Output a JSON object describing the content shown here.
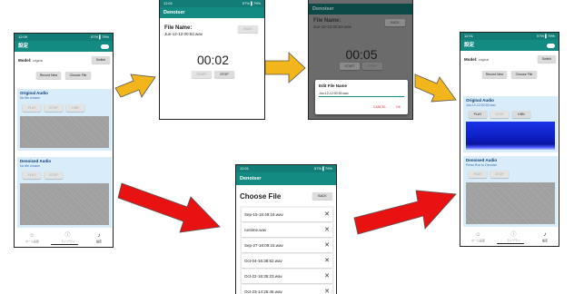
{
  "phone1": {
    "status_time": "12:09",
    "status_right": "57% ▌79%",
    "app_title": "設定",
    "model_label": "Model:",
    "model_value": "original",
    "switch_label": "Switch",
    "record_new_label": "Record New",
    "choose_file_label": "Choose File",
    "original_title": "Original Audio",
    "original_sub": "No file chosen",
    "denoised_title": "Denoised Audio",
    "denoised_sub": "No file chosen",
    "play_label": "PLAY",
    "stop_label": "STOP",
    "kbn_label": "KBN",
    "nav": [
      "ホーム画面",
      "ライブラリ",
      "設定"
    ]
  },
  "phone2": {
    "status_time": "12:01",
    "app_title": "Denoiser",
    "file_name_label": "File Name:",
    "file_name_value": "Jun-12-12:00:53.wav",
    "back_label": "BACK",
    "timer": "00:02",
    "start_label": "START",
    "stop_label": "STOP"
  },
  "phone3": {
    "app_title": "Denoiser",
    "file_name_label": "File Name:",
    "file_name_value": "Jun-12-12:00:53.wav",
    "back_label": "BACK",
    "timer": "00:05",
    "start_label": "START",
    "stop_label": "STOP",
    "dialog_title": "Edit File Name",
    "dialog_value": "Jun-12-12:00:53.wav",
    "cancel_label": "CANCEL",
    "ok_label": "OK"
  },
  "phone4": {
    "status_time": "12:01",
    "status_right": "57% ▌79%",
    "app_title": "設定",
    "model_label": "Model:",
    "model_value": "original",
    "switch_label": "Switch",
    "record_new_label": "Record New",
    "choose_file_label": "Choose File",
    "original_title": "Original Audio",
    "original_sub": "Jun-12-12:00:53.wav",
    "denoised_title": "Denoised Audio",
    "denoised_sub": "Press Run to Denoise",
    "play_label": "PLAY",
    "stop_label": "STOP",
    "kbn_label": "KBN",
    "nav": [
      "ホーム画面",
      "ライブラリ",
      "設定"
    ]
  },
  "phone5": {
    "status_time": "12:01",
    "status_right": "57% ▌79%",
    "app_title": "Denoiser",
    "choose_file_title": "Choose File",
    "back_label": "BACK",
    "files": [
      "Sep-15-16:49:18.wav",
      "runtime.wav",
      "Sep-27-16:09:15.wav",
      "Oct-04-16:38:52.wav",
      "Oct-22-16:35:23.wav",
      "Oct-23-14:25:46.wav"
    ]
  },
  "colors": {
    "teal": "#138a82",
    "panel": "#d8ecf9",
    "arrow_yellow": "#f3b51c",
    "arrow_red": "#e81212",
    "spectrogram": "#1020c8"
  }
}
